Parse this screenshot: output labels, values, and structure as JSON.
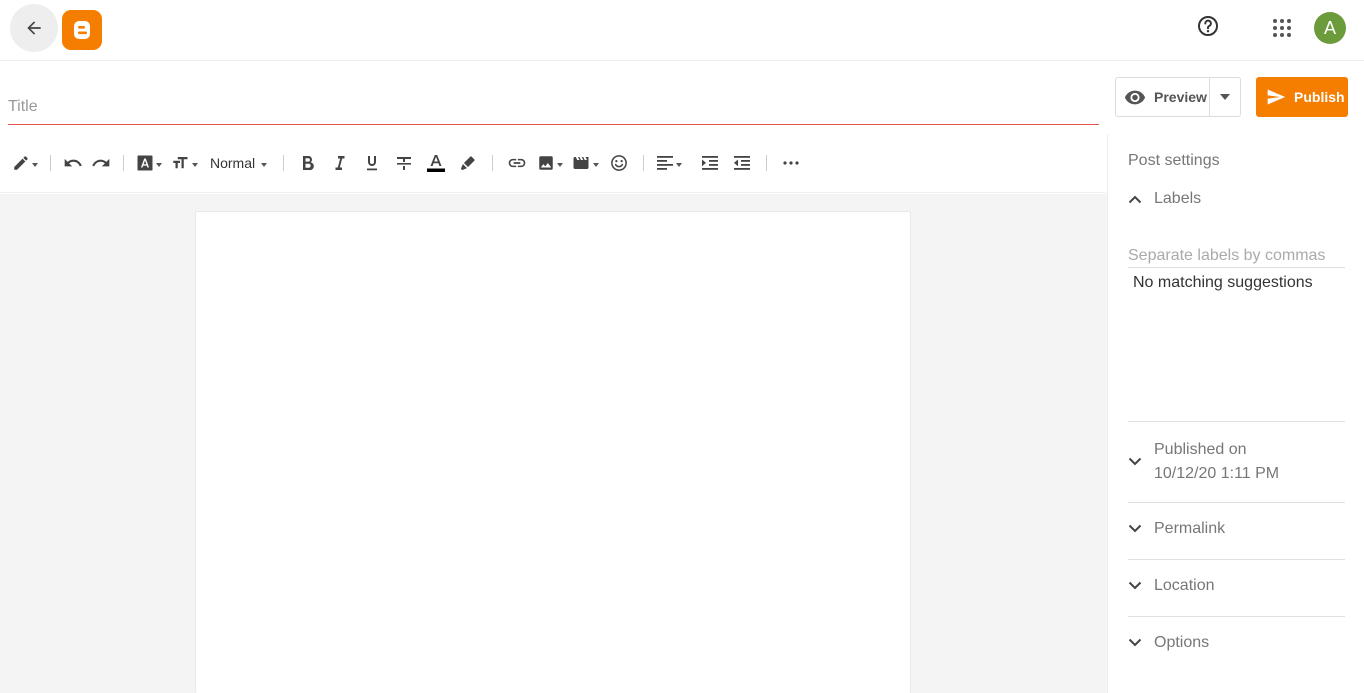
{
  "app": {
    "avatar_letter": "A",
    "brand_color": "#f57d00"
  },
  "editor": {
    "title_placeholder": "Title",
    "format_select": "Normal"
  },
  "actions": {
    "preview_label": "Preview",
    "publish_label": "Publish"
  },
  "sidebar": {
    "title": "Post settings",
    "labels": {
      "heading": "Labels",
      "placeholder": "Separate labels by commas",
      "no_match": "No matching suggestions"
    },
    "published": {
      "line1": "Published on",
      "line2": "10/12/20 1:11 PM"
    },
    "permalink": "Permalink",
    "location": "Location",
    "options": "Options"
  }
}
